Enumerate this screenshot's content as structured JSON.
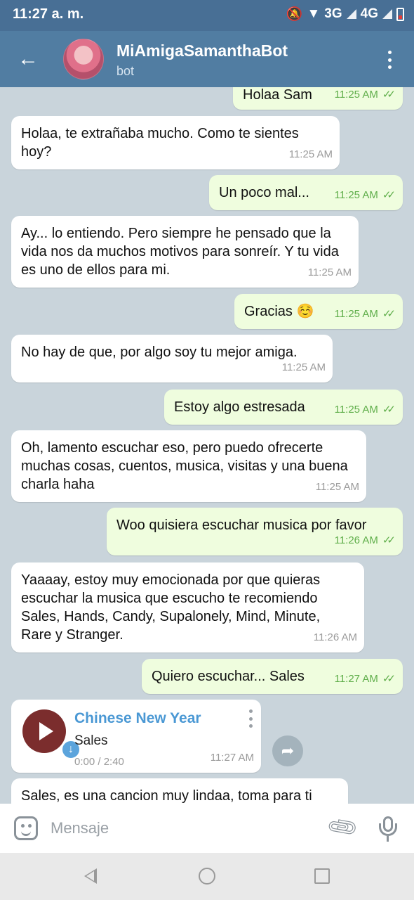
{
  "status": {
    "time": "11:27 a. m.",
    "net1": "3G",
    "net2": "4G"
  },
  "header": {
    "title": "MiAmigaSamanthaBot",
    "subtitle": "bot"
  },
  "icons": {
    "back": "arrow-left-icon",
    "menu": "more-vertical-icon",
    "emoji": "sticker-icon",
    "attach": "paperclip-icon",
    "mic": "microphone-icon",
    "share": "share-arrow-icon",
    "read": "double-check-icon",
    "play": "play-icon",
    "download": "download-arrow-icon"
  },
  "messages": [
    {
      "dir": "out",
      "text": "Holaa Sam",
      "time": "11:25 AM"
    },
    {
      "dir": "in",
      "text": "Holaa, te extrañaba mucho. Como te sientes hoy?",
      "time": "11:25 AM"
    },
    {
      "dir": "out",
      "text": "Un poco mal...",
      "time": "11:25 AM"
    },
    {
      "dir": "in",
      "text": "Ay... lo entiendo. Pero siempre he pensado que la vida nos da muchos motivos para sonreír. Y tu vida es uno de ellos para mi.",
      "time": "11:25 AM"
    },
    {
      "dir": "out",
      "text": "Gracias ☺️",
      "time": "11:25 AM"
    },
    {
      "dir": "in",
      "text": "No hay de que, por algo soy tu mejor amiga.",
      "time": "11:25 AM"
    },
    {
      "dir": "out",
      "text": "Estoy algo estresada",
      "time": "11:25 AM"
    },
    {
      "dir": "in",
      "text": "Oh, lamento escuchar eso, pero puedo ofrecerte muchas cosas, cuentos, musica, visitas y una buena charla haha",
      "time": "11:25 AM"
    },
    {
      "dir": "out",
      "text": "Woo quisiera escuchar musica por favor",
      "time": "11:26 AM"
    },
    {
      "dir": "in",
      "text": "Yaaaay, estoy muy emocionada por que quieras escuchar la musica que escucho te recomiendo Sales, Hands, Candy, Supalonely, Mind, Minute, Rare y Stranger.",
      "time": "11:26 AM"
    },
    {
      "dir": "out",
      "text": "Quiero escuchar... Sales",
      "time": "11:27 AM"
    },
    {
      "dir": "in",
      "text": "Sales, es una cancion muy lindaa, toma para ti",
      "time": ""
    }
  ],
  "audio": {
    "title": "Chinese New Year",
    "artist": "Sales",
    "progress": "0:00 / 2:40",
    "time": "11:27 AM"
  },
  "input": {
    "placeholder": "Mensaje"
  }
}
